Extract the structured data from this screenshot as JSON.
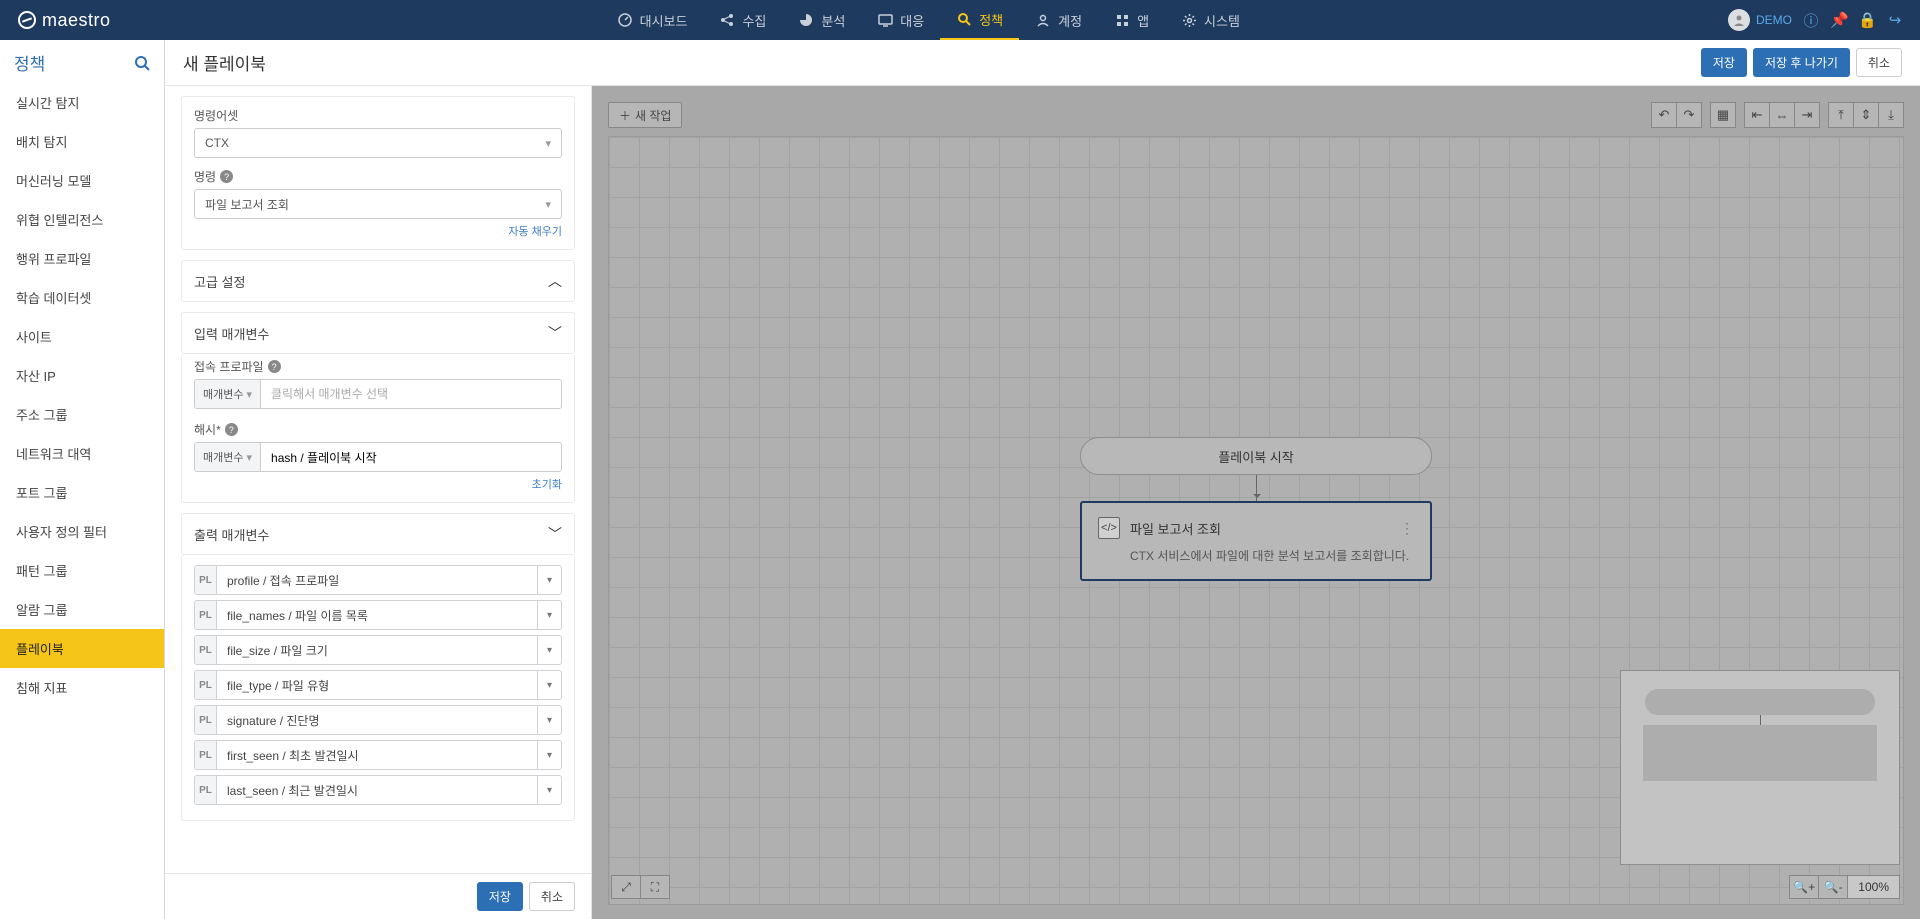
{
  "app": {
    "name": "maestro"
  },
  "topnav": [
    {
      "label": "대시보드",
      "active": false,
      "icon": "dashboard"
    },
    {
      "label": "수집",
      "active": false,
      "icon": "share"
    },
    {
      "label": "분석",
      "active": false,
      "icon": "pie"
    },
    {
      "label": "대응",
      "active": false,
      "icon": "monitor"
    },
    {
      "label": "정책",
      "active": true,
      "icon": "search"
    },
    {
      "label": "계정",
      "active": false,
      "icon": "user"
    },
    {
      "label": "앱",
      "active": false,
      "icon": "grid"
    },
    {
      "label": "시스템",
      "active": false,
      "icon": "gear"
    }
  ],
  "user": {
    "name": "DEMO"
  },
  "sidebar": {
    "title": "정책",
    "items": [
      "실시간 탐지",
      "배치 탐지",
      "머신러닝 모델",
      "위협 인텔리전스",
      "행위 프로파일",
      "학습 데이터셋",
      "사이트",
      "자산 IP",
      "주소 그룹",
      "네트워크 대역",
      "포트 그룹",
      "사용자 정의 필터",
      "패턴 그룹",
      "알람 그룹",
      "플레이북",
      "침해 지표"
    ],
    "active_index": 14
  },
  "page": {
    "title": "새 플레이북",
    "actions": {
      "save": "저장",
      "save_exit": "저장 후 나가기",
      "cancel": "취소"
    }
  },
  "panel": {
    "cmdset_label": "명령어셋",
    "cmdset_value": "CTX",
    "cmd_label": "명령",
    "cmd_value": "파일 보고서 조회",
    "autofill": "자동 채우기",
    "advanced_label": "고급 설정",
    "input_params_label": "입력 매개변수",
    "profile_label": "접속 프로파일",
    "param_tag": "매개변수",
    "profile_placeholder": "클릭해서 매개변수 선택",
    "hash_label": "해시*",
    "hash_value": "hash / 플레이북 시작",
    "reset": "초기화",
    "output_params_label": "출력 매개변수",
    "outputs": [
      "profile / 접속 프로파일",
      "file_names / 파일 이름 목록",
      "file_size / 파일 크기",
      "file_type / 파일 유형",
      "signature / 진단명",
      "first_seen / 최초 발견일시",
      "last_seen / 최근 발견일시"
    ],
    "footer": {
      "save": "저장",
      "cancel": "취소"
    }
  },
  "canvas": {
    "new_task": "새 작업",
    "start_node": "플레이북 시작",
    "task": {
      "title": "파일 보고서 조회",
      "desc": "CTX 서비스에서 파일에 대한 분석 보고서를 조회합니다."
    },
    "zoom": "100%"
  }
}
